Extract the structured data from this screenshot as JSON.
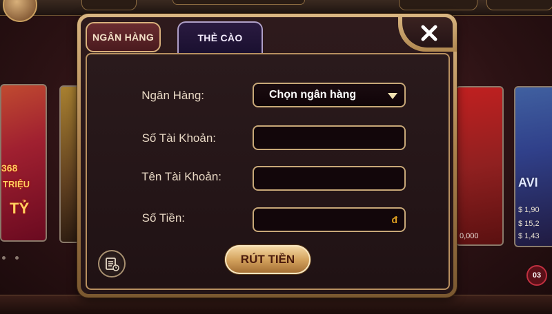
{
  "dialog": {
    "tabs": [
      {
        "label": "NGÂN HÀNG",
        "active": true
      },
      {
        "label": "THẺ CÀO",
        "active": false
      }
    ],
    "close_icon": "close-icon"
  },
  "form": {
    "bank_label": "Ngân Hàng:",
    "bank_select_value": "Chọn ngân hàng",
    "account_number_label": "Số Tài Khoản:",
    "account_number_value": "",
    "account_name_label": "Tên Tài Khoản:",
    "account_name_value": "",
    "amount_label": "Số Tiền:",
    "amount_value": "",
    "currency_symbol": "đ"
  },
  "actions": {
    "withdraw_label": "RÚT TIỀN",
    "history_icon": "history-icon"
  },
  "background": {
    "card1_lines": [
      "TRIỆU",
      "TỶ"
    ],
    "card1_number": "368",
    "card3_amount": "0,000",
    "card4_title": "AVI",
    "card4_money": [
      "$ 1,90",
      "$ 15,2",
      "$ 1,43"
    ],
    "badge": "03"
  },
  "colors": {
    "accent_gold": "#d9b682",
    "panel_bg": "#241416",
    "tab_active": "#5a2226",
    "tab_inactive": "#221436"
  }
}
